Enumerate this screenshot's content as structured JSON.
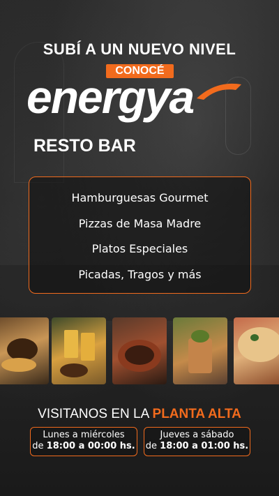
{
  "headline": "SUBÍ A UN NUEVO NIVEL",
  "badge": "CONOCÉ",
  "brand": {
    "name_main": "energy",
    "name_tail": "a",
    "subtitle": "RESTO BAR",
    "accent_color": "#f26b1d"
  },
  "menu": {
    "items": [
      "Hamburguesas Gourmet",
      "Pizzas de Masa Madre",
      "Platos Especiales",
      "Picadas, Tragos y más"
    ]
  },
  "photos": [
    "burger-photo",
    "beer-photo",
    "stew-photo",
    "cocktail-photo",
    "pizza-photo"
  ],
  "visit": {
    "prefix": "VISITANOS EN LA ",
    "highlight": "PLANTA ALTA"
  },
  "schedule": [
    {
      "days": "Lunes a miércoles",
      "prefix": "de ",
      "time": "18:00 a 00:00 hs."
    },
    {
      "days": "Jueves a sábado",
      "prefix": "de ",
      "time": "18:00 a 01:00 hs."
    }
  ]
}
